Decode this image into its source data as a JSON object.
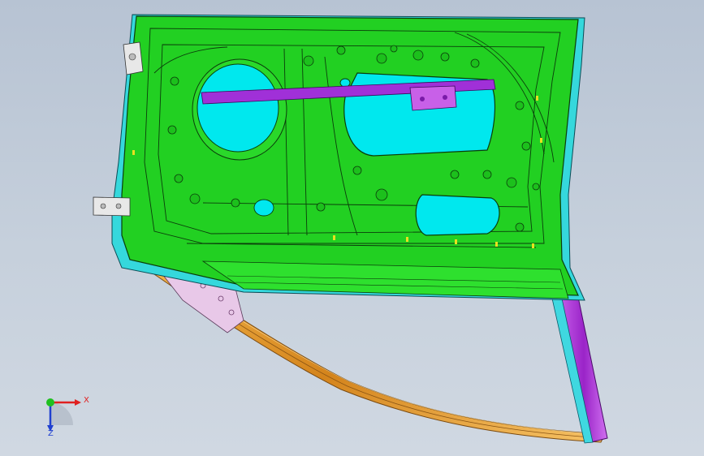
{
  "viewport": {
    "background_top": "#b7c3d3",
    "background_bottom": "#d0d8e2"
  },
  "model": {
    "panel_color": "#22d022",
    "panel_edge_color": "#0b3d0b",
    "opening_color": "#00e8ee",
    "bracket_color": "#b040e0",
    "frame_color": "#e09a30",
    "hinge_color": "#e8e8e8"
  },
  "triad": {
    "x_label": "X",
    "z_label": "Z",
    "x_color": "#e02020",
    "y_color": "#20c020",
    "z_color": "#2040d0"
  }
}
